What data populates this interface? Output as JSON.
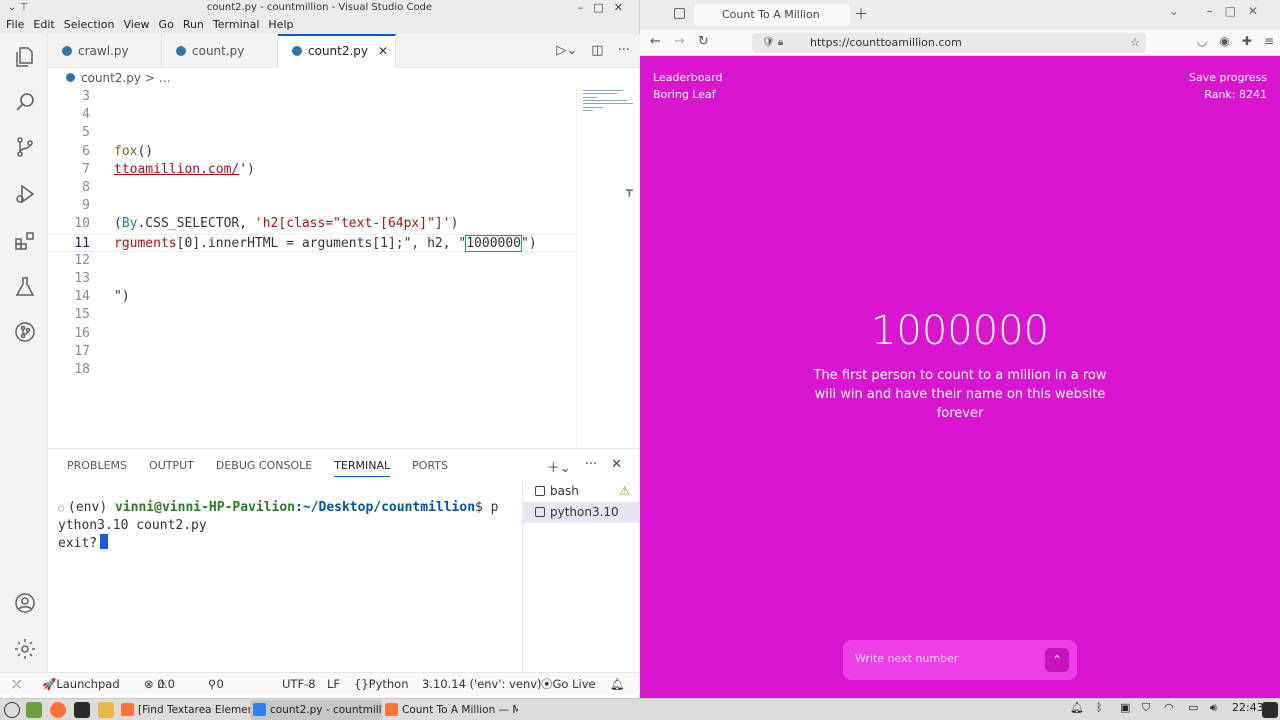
{
  "vscode": {
    "title": "count2.py - countmillion - Visual Studio Code",
    "menu": [
      "File",
      "Edit",
      "Selection",
      "View",
      "Go",
      "Run",
      "Terminal",
      "Help"
    ],
    "tabs": [
      {
        "label": "crawl.py"
      },
      {
        "label": "count.py"
      },
      {
        "label": "count2.py"
      }
    ],
    "breadcrumb": {
      "file": "count2.py",
      "sep": "> …"
    },
    "lines": [
      {
        "n": "3",
        "code": ""
      },
      {
        "n": "4",
        "code": ""
      },
      {
        "n": "5",
        "code": ""
      },
      {
        "n": "6",
        "code": "fox()"
      },
      {
        "n": "7",
        "code": "ttoamillion.com/')"
      },
      {
        "n": "8",
        "code": ""
      },
      {
        "n": "9",
        "code": ""
      },
      {
        "n": "10",
        "code": "(By.CSS_SELECTOR, 'h2[class=\"text-[64px]\"]')"
      },
      {
        "n": "11",
        "code": "rguments[0].innerHTML = arguments[1];\", h2, \"1000000\")"
      },
      {
        "n": "12",
        "code": ""
      },
      {
        "n": "13",
        "code": ""
      },
      {
        "n": "14",
        "code": "\")"
      },
      {
        "n": "15",
        "code": ""
      },
      {
        "n": "16",
        "code": ""
      },
      {
        "n": "17",
        "code": ""
      },
      {
        "n": "18",
        "code": ""
      }
    ],
    "panel_tabs": [
      "PROBLEMS",
      "OUTPUT",
      "DEBUG CONSOLE",
      "TERMINAL",
      "PORTS"
    ],
    "terminal": {
      "env": "(env)",
      "user": "vinni@vinni-HP-Pavilion",
      "path": ":~/Desktop/countmillion",
      "prompt_tail": "$ p",
      "line2": "ython3.10 count2.py",
      "line3": "exit?"
    },
    "terminals": [
      {
        "label": "bash"
      },
      {
        "label": "python3.10"
      }
    ],
    "status": {
      "launchpad": "Launchpad",
      "errors": "0",
      "warnings": "0",
      "ports": "0",
      "encoding": "UTF-8",
      "eol": "LF",
      "language": "Python",
      "interpreter": "3.10.14 ('env': venv)",
      "golive": "Go Live"
    }
  },
  "firefox": {
    "tab_title": "Count To A Million",
    "url": "https://counttoamillion.com",
    "leaderboard": "Leaderboard",
    "username": "Boring Leaf",
    "save_progress": "Save progress",
    "rank": "Rank: 8241",
    "count": "1000000",
    "description": "The first person to count to a million in a row will win and have their name on this website forever",
    "input_placeholder": "Write next number",
    "bg_color": "#d816cf"
  },
  "taskbar": {
    "tasks": [
      {
        "label": "[Find Textarea Element..."
      },
      {
        "label": "count2.py - countmillio..."
      },
      {
        "label": "Count To A Million — M..."
      }
    ],
    "clock": "22:43"
  }
}
